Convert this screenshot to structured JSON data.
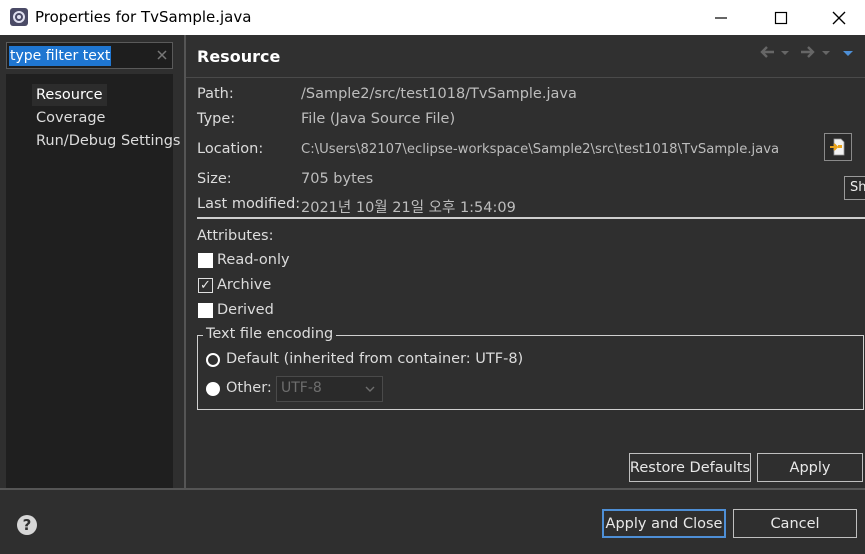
{
  "window": {
    "title": "Properties for TvSample.java"
  },
  "left": {
    "filter": {
      "value": "type filter text"
    },
    "tree": [
      {
        "label": "Resource",
        "selected": true
      },
      {
        "label": "Coverage",
        "selected": false
      },
      {
        "label": "Run/Debug Settings",
        "selected": false
      }
    ]
  },
  "page": {
    "title": "Resource",
    "info": {
      "path_label": "Path:",
      "path_value": "/Sample2/src/test1018/TvSample.java",
      "type_label": "Type:",
      "type_value": "File  (Java Source File)",
      "location_label": "Location:",
      "location_value": "C:\\Users\\82107\\eclipse-workspace\\Sample2\\src\\test1018\\TvSample.java",
      "size_label": "Size:",
      "size_value": "705  bytes",
      "modified_label": "Last modified:",
      "modified_value": "2021년 10월 21일 오후 1:54:09"
    },
    "tooltip": "Sh",
    "attributes": {
      "label": "Attributes:",
      "readonly": {
        "label": "Read-only",
        "checked": false
      },
      "archive": {
        "label": "Archive",
        "checked": true
      },
      "derived": {
        "label": "Derived",
        "checked": false
      }
    },
    "encoding": {
      "label": "Text file encoding",
      "default_label": "Default (inherited from container: UTF-8)",
      "other_label": "Other:",
      "other_value": "UTF-8",
      "selected": "other"
    },
    "restore_defaults": "Restore Defaults",
    "apply": "Apply"
  },
  "footer": {
    "apply_close": "Apply and Close",
    "cancel": "Cancel"
  },
  "colors": {
    "background": "#2f2f2f",
    "tree_background": "#1f1f1f",
    "selection": "#1f76d1",
    "focus_border": "#4e8fd6"
  }
}
